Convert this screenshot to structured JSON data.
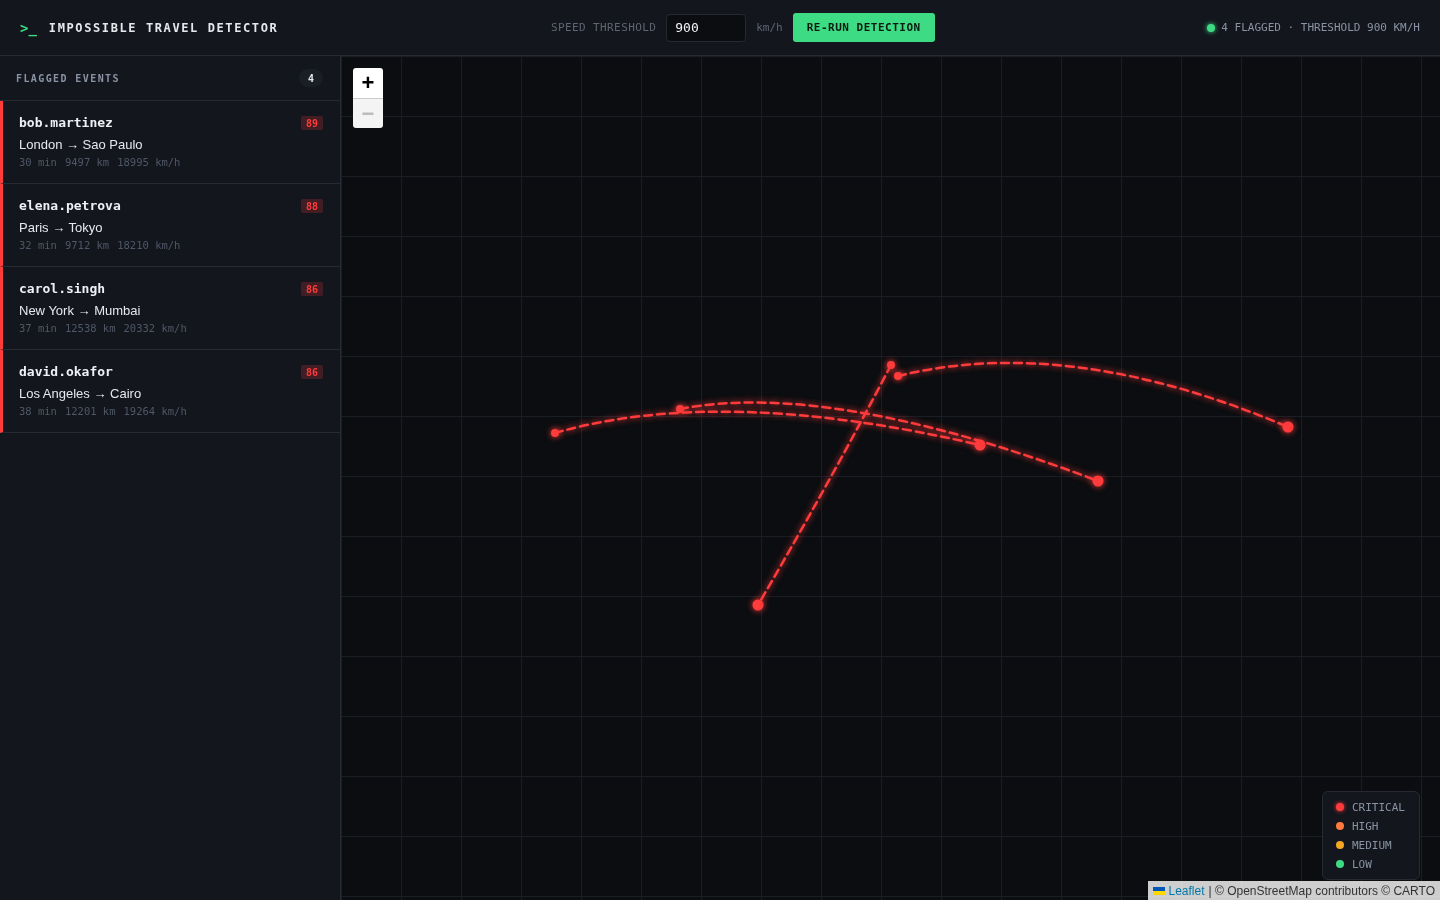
{
  "header": {
    "prompt": ">_",
    "title": "IMPOSSIBLE TRAVEL DETECTOR",
    "threshold_label": "SPEED THRESHOLD",
    "threshold_value": "900",
    "threshold_unit": "km/h",
    "rerun_button": "RE-RUN DETECTION",
    "status": "4 FLAGGED · THRESHOLD 900 KM/H"
  },
  "sidebar": {
    "title": "FLAGGED EVENTS",
    "count": "4",
    "events": [
      {
        "user": "bob.martinez",
        "score": "89",
        "route": "London → Sao Paulo",
        "stats": [
          "30 min",
          "9497 km",
          "18995 km/h"
        ],
        "color": "#ff3b3b"
      },
      {
        "user": "elena.petrova",
        "score": "88",
        "route": "Paris → Tokyo",
        "stats": [
          "32 min",
          "9712 km",
          "18210 km/h"
        ],
        "color": "#ff3b3b"
      },
      {
        "user": "carol.singh",
        "score": "86",
        "route": "New York → Mumbai",
        "stats": [
          "37 min",
          "12538 km",
          "20332 km/h"
        ],
        "color": "#ff3b3b"
      },
      {
        "user": "david.okafor",
        "score": "86",
        "route": "Los Angeles → Cairo",
        "stats": [
          "38 min",
          "12201 km",
          "19264 km/h"
        ],
        "color": "#ff3b3b"
      }
    ]
  },
  "map": {
    "zoom_in": "+",
    "zoom_out": "−",
    "zoom_out_disabled": true,
    "legend": [
      {
        "label": "CRITICAL",
        "color": "#ff3b3b"
      },
      {
        "label": "HIGH",
        "color": "#ff7a3d"
      },
      {
        "label": "MEDIUM",
        "color": "#f5a623"
      },
      {
        "label": "LOW",
        "color": "#3ddc84"
      }
    ],
    "attribution": {
      "link": "Leaflet",
      "text": "| © OpenStreetMap contributors © CARTO"
    }
  }
}
